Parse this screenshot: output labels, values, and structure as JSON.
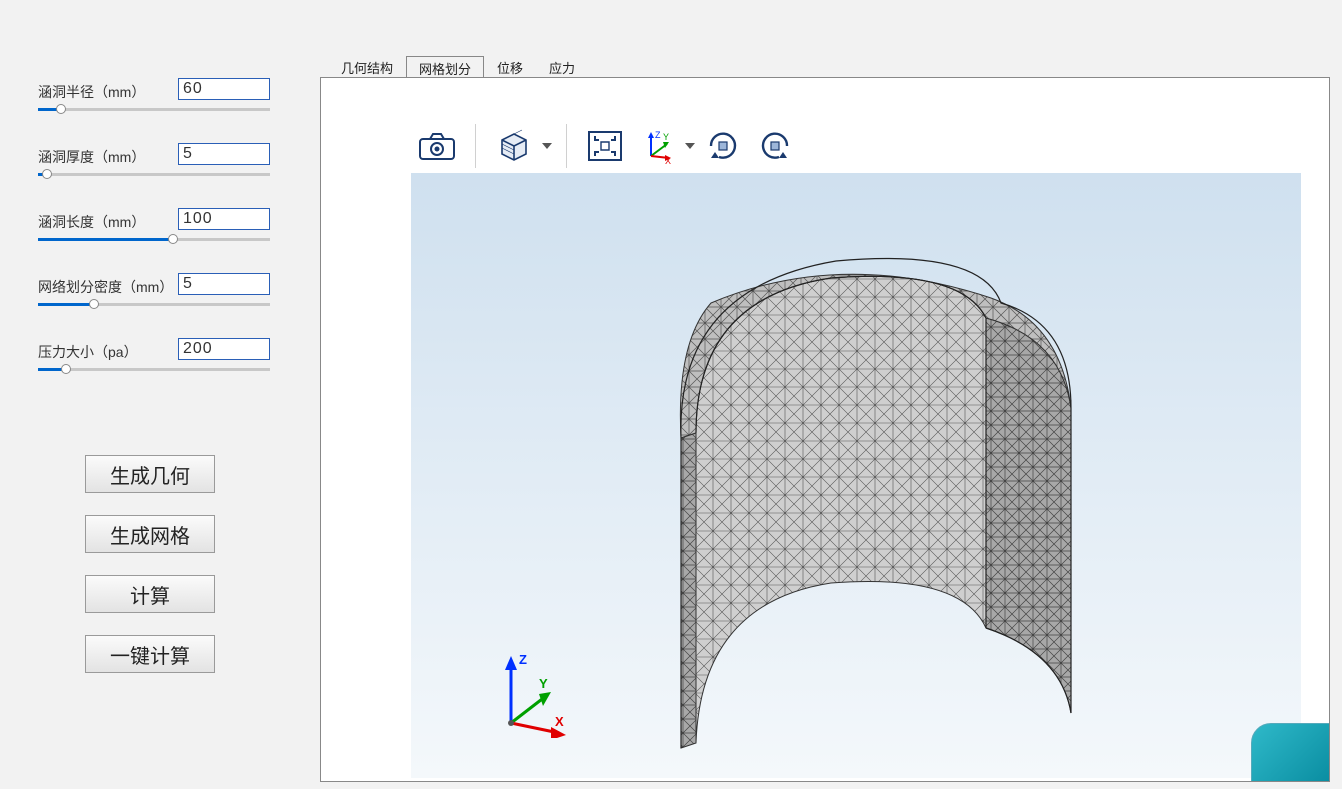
{
  "params": [
    {
      "label": "涵洞半径（mm）",
      "value": "60",
      "fill_pct": 10
    },
    {
      "label": "涵洞厚度（mm）",
      "value": "5",
      "fill_pct": 4
    },
    {
      "label": "涵洞长度（mm）",
      "value": "100",
      "fill_pct": 58
    },
    {
      "label": "网络划分密度（mm）",
      "value": "5",
      "fill_pct": 24
    },
    {
      "label": "压力大小（pa）",
      "value": "200",
      "fill_pct": 12
    }
  ],
  "buttons": {
    "generate_geometry": "生成几何",
    "generate_mesh": "生成网格",
    "compute": "计算",
    "one_click_compute": "一键计算"
  },
  "tabs": [
    {
      "id": "geometry",
      "label": "几何结构",
      "active": false
    },
    {
      "id": "mesh",
      "label": "网格划分",
      "active": true
    },
    {
      "id": "disp",
      "label": "位移",
      "active": false
    },
    {
      "id": "stress",
      "label": "应力",
      "active": false
    }
  ],
  "toolbar": {
    "icons": {
      "screenshot": "screenshot-icon",
      "view_cube": "view-cube-icon",
      "fit_extent": "fit-extent-icon",
      "axes": "axes-orientation-icon",
      "rotate_cw": "rotate-cw-icon",
      "rotate_ccw": "rotate-ccw-icon"
    }
  },
  "axes": {
    "x": "X",
    "y": "Y",
    "z": "Z"
  }
}
